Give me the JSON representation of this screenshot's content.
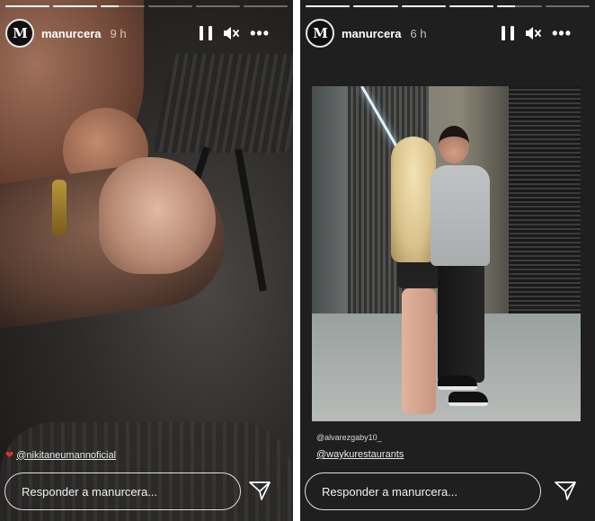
{
  "stories": [
    {
      "username": "manurcera",
      "time": "9 h",
      "avatar_letter": "M",
      "progress": [
        1,
        1,
        0.4,
        0,
        0,
        0
      ],
      "mention": "@nikitaneumannoficial",
      "mention_prefix_icon": "heart-emoji",
      "reply_placeholder": "Responder a manurcera..."
    },
    {
      "username": "manurcera",
      "time": "6 h",
      "avatar_letter": "M",
      "progress": [
        1,
        1,
        1,
        1,
        0.4,
        0
      ],
      "photo_tag": "@alvarezgaby10_",
      "mention": "@waykurestaurants",
      "reply_placeholder": "Responder a manurcera..."
    }
  ],
  "icons": {
    "pause": "pause-icon",
    "mute": "speaker-muted-icon",
    "more": "more-options-icon",
    "send": "paper-plane-icon"
  },
  "colors": {
    "progress_fill": "#ffffff",
    "progress_track": "rgba(255,255,255,0.35)",
    "heart": "#e0312a"
  }
}
